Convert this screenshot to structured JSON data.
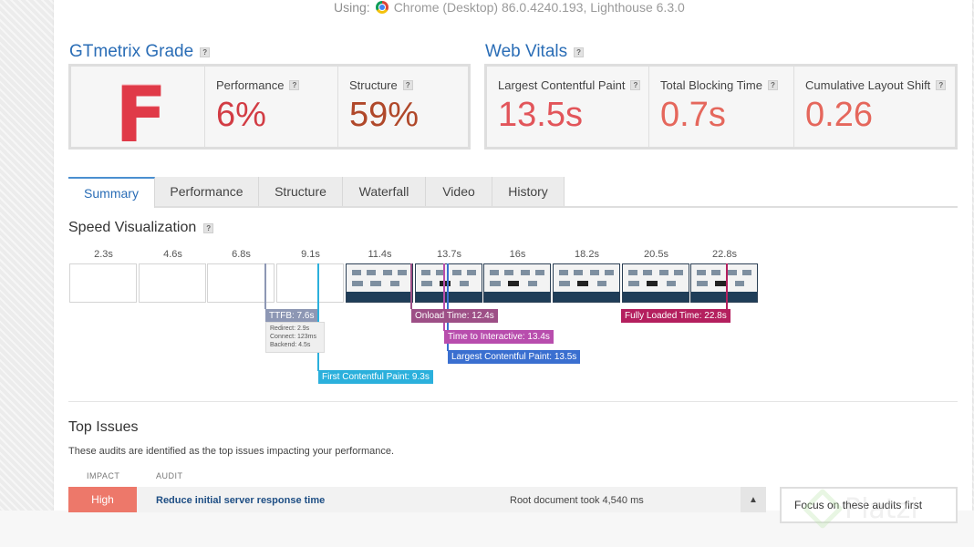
{
  "using": {
    "label": "Using:",
    "browser": "Chrome (Desktop) 86.0.4240.193, Lighthouse 6.3.0"
  },
  "grade": {
    "title": "GTmetrix Grade",
    "letter": "F",
    "performance": {
      "label": "Performance",
      "value": "6%",
      "color": "#d23c44"
    },
    "structure": {
      "label": "Structure",
      "value": "59%",
      "color": "#b0482a"
    }
  },
  "vitals": {
    "title": "Web Vitals",
    "lcp": {
      "label": "Largest Contentful Paint",
      "value": "13.5s",
      "color": "#e2555a"
    },
    "tbt": {
      "label": "Total Blocking Time",
      "value": "0.7s",
      "color": "#e5675c"
    },
    "cls": {
      "label": "Cumulative Layout Shift",
      "value": "0.26",
      "color": "#e5675c"
    }
  },
  "tabs": [
    "Summary",
    "Performance",
    "Structure",
    "Waterfall",
    "Video",
    "History"
  ],
  "speed": {
    "title": "Speed Visualization",
    "times": [
      "2.3s",
      "4.6s",
      "6.8s",
      "9.1s",
      "11.4s",
      "13.7s",
      "16s",
      "18.2s",
      "20.5s",
      "22.8s"
    ],
    "markers": {
      "ttfb": {
        "label": "TTFB: 7.6s",
        "color": "#8d97b4"
      },
      "ttfb_details": [
        "Redirect: 2.9s",
        "Connect: 123ms",
        "Backend: 4.5s"
      ],
      "onload": {
        "label": "Onload Time: 12.4s",
        "color": "#9d4f86"
      },
      "tti": {
        "label": "Time to Interactive: 13.4s",
        "color": "#b84dad"
      },
      "lcp": {
        "label": "Largest Contentful Paint: 13.5s",
        "color": "#3a6fd0"
      },
      "fcp": {
        "label": "First Contentful Paint: 9.3s",
        "color": "#2bb0dc"
      },
      "fully": {
        "label": "Fully Loaded Time: 22.8s",
        "color": "#b41f5e"
      }
    }
  },
  "issues": {
    "title": "Top Issues",
    "description": "These audits are identified as the top issues impacting your performance.",
    "col_impact": "IMPACT",
    "col_audit": "AUDIT",
    "rows": [
      {
        "impact": "High",
        "audit": "Reduce initial server response time",
        "detail": "Root document took 4,540 ms"
      }
    ],
    "focus": "Focus on these audits first"
  },
  "watermark": "Platzi"
}
